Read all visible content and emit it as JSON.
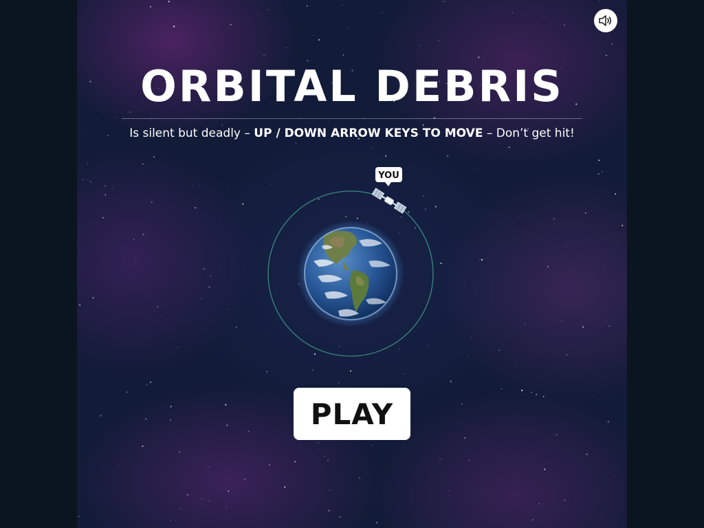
{
  "game": {
    "title": "ORBITAL DEBRIS",
    "subtitle": {
      "part1": "Is silent but deadly – ",
      "controls": "UP / DOWN ARROW KEYS TO MOVE",
      "part2": " – Don’t get hit!"
    },
    "player_marker": "YOU",
    "play_label": "PLAY",
    "sound_icon": "speaker-icon"
  },
  "colors": {
    "background_outer": "#0a1520",
    "space_base": "#121b38",
    "nebula": "#6e2882",
    "orbit_line": "#3e8a80",
    "button_bg": "#ffffff",
    "button_text": "#111111"
  }
}
